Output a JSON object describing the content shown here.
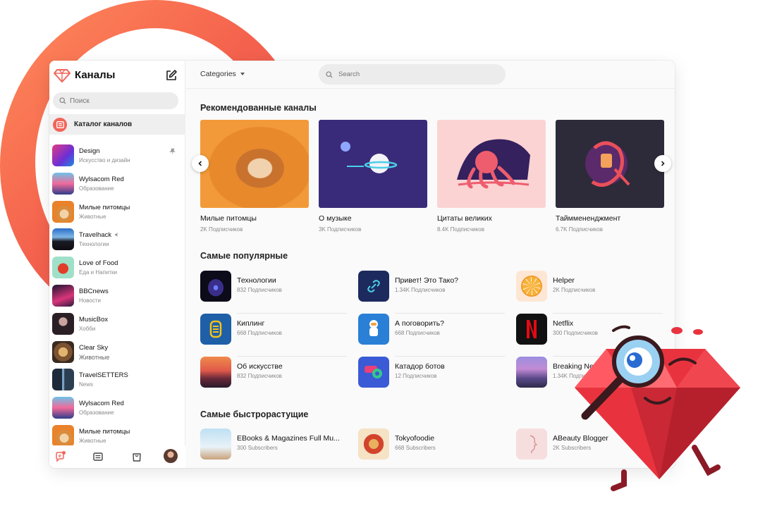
{
  "sidebar": {
    "title": "Каналы",
    "search_placeholder": "Поиск",
    "catalog_label": "Каталог каналов",
    "channels": [
      {
        "name": "Design",
        "sub": "Искусство и дизайн"
      },
      {
        "name": "Wylsacom Red",
        "sub": "Образование"
      },
      {
        "name": "Милые питомцы",
        "sub": "Животные"
      },
      {
        "name": "Travelhack",
        "sub": "Технологии"
      },
      {
        "name": "Love of Food",
        "sub": "Еда и Напитки"
      },
      {
        "name": "BBCnews",
        "sub": "Новости"
      },
      {
        "name": "MusicBox",
        "sub": "Хобби"
      },
      {
        "name": "Clear Sky",
        "sub": "Животные"
      },
      {
        "name": "TravelSETTERS",
        "sub": "News"
      },
      {
        "name": "Wylsacom Red",
        "sub": "Образование"
      },
      {
        "name": "Милые питомцы",
        "sub": "Животные"
      }
    ]
  },
  "topbar": {
    "categories_label": "Categories",
    "search_placeholder": "Search"
  },
  "recommended": {
    "title": "Рекомендованные каналы",
    "items": [
      {
        "name": "Милые питомцы",
        "sub": "2K Подписчиков"
      },
      {
        "name": "О музыке",
        "sub": "3K Подписчиков"
      },
      {
        "name": "Цитаты великих",
        "sub": "8.4K Подписчиков"
      },
      {
        "name": "Тайммененджмент",
        "sub": "6.7K Подписчиков"
      }
    ]
  },
  "popular": {
    "title": "Самые популярные",
    "items": [
      {
        "name": "Технологии",
        "sub": "832 Подписчиков"
      },
      {
        "name": "Привет! Это Тако?",
        "sub": "1.34K Подписчиков"
      },
      {
        "name": "Helper",
        "sub": "2K Подписчиков"
      },
      {
        "name": "Киплинг",
        "sub": "668 Подписчиков"
      },
      {
        "name": "А поговорить?",
        "sub": "668 Подписчиков"
      },
      {
        "name": "Netflix",
        "sub": "300 Подписчиков"
      },
      {
        "name": "Об искусстве",
        "sub": "832 Подписчиков"
      },
      {
        "name": "Катадор ботов",
        "sub": "12 Подписчиков"
      },
      {
        "name": "Breaking News",
        "sub": "1.34K Подписчиков"
      }
    ]
  },
  "fastest": {
    "title": "Самые быстрорастущие",
    "items": [
      {
        "name": "EBooks & Magazines Full Mu...",
        "sub": "300 Subscribers"
      },
      {
        "name": "Tokyofoodie",
        "sub": "668 Subscribers"
      },
      {
        "name": "ABeauty Blogger",
        "sub": "2K Subscribers"
      }
    ]
  },
  "colors": {
    "accent": "#f1655a",
    "arc": "#f4624d",
    "ruby": "#e8333f"
  }
}
